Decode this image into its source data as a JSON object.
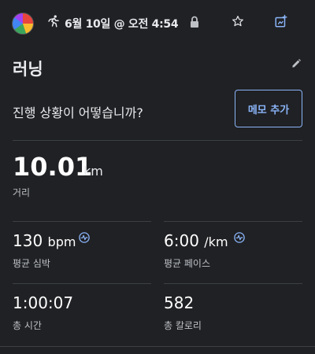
{
  "topbar": {
    "date_time": "6월 10일 @ 오전 4:54",
    "icons": [
      "avatar",
      "run-icon",
      "lock-icon",
      "star-icon",
      "share-icon"
    ]
  },
  "activity": {
    "title": "러닝",
    "progress_question": "진행 상황이 어떻습니까?",
    "memo_button": "메모 추가"
  },
  "distance": {
    "value": "10.01",
    "unit": "km",
    "label": "거리"
  },
  "stats": {
    "heart_rate": {
      "value": "130",
      "unit": "bpm",
      "label": "평균 심박"
    },
    "pace": {
      "value": "6:00",
      "unit": "/km",
      "label": "평균 페이스"
    },
    "time": {
      "value": "1:00:07",
      "label": "총 시간"
    },
    "calories": {
      "value": "582",
      "label": "총 칼로리"
    }
  },
  "colors": {
    "background": "#202124",
    "accent": "#8ab4f8",
    "text": "#e8eaed",
    "label": "#bdc1c6",
    "divider": "#3c4043"
  }
}
